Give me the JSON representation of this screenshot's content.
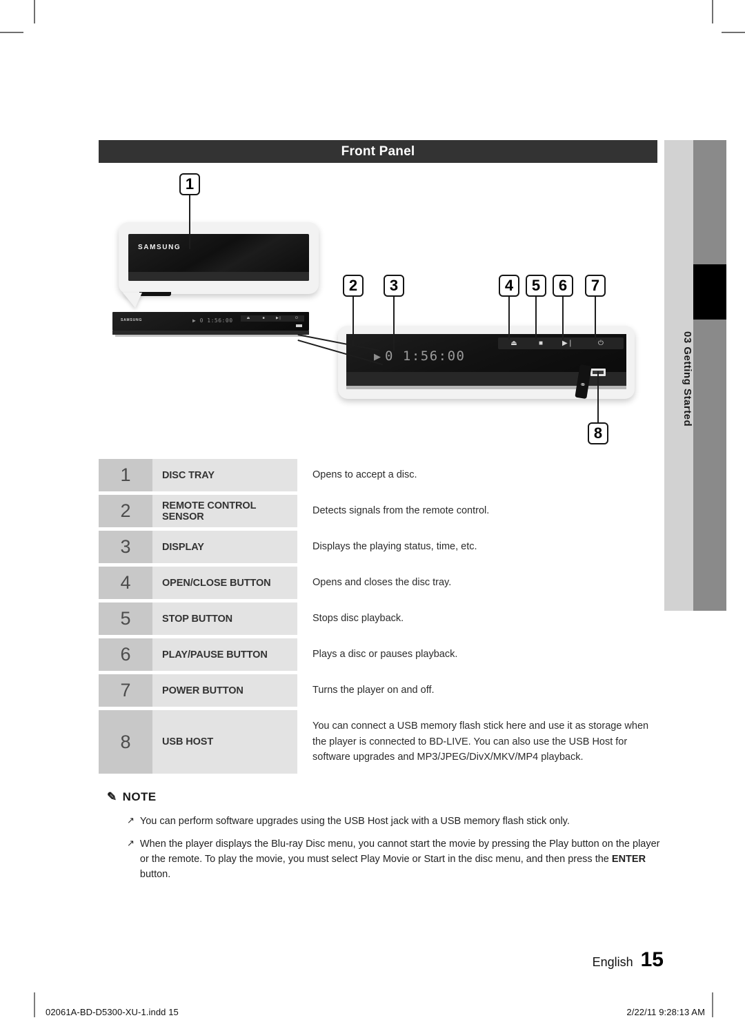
{
  "section": {
    "title": "Front Panel"
  },
  "side_tab": {
    "chapter_number": "03",
    "chapter_name": "Getting Started",
    "combined": "03  Getting Started"
  },
  "diagram": {
    "brand_logo": "SAMSUNG",
    "display_readout": "0 1:56:00",
    "display_play_icon": "▶",
    "buttons": [
      {
        "name": "eject-button-icon",
        "glyph": "⏏"
      },
      {
        "name": "stop-button-icon",
        "glyph": "■"
      },
      {
        "name": "play-pause-button-icon",
        "glyph": "▶❘"
      },
      {
        "name": "power-button-icon",
        "glyph": "⏻"
      }
    ],
    "usb_symbol": "⚭",
    "callouts": [
      "1",
      "2",
      "3",
      "4",
      "5",
      "6",
      "7",
      "8"
    ]
  },
  "spec_table": {
    "rows": [
      {
        "num": "1",
        "label": "DISC TRAY",
        "desc": "Opens to accept a disc."
      },
      {
        "num": "2",
        "label": "REMOTE CONTROL SENSOR",
        "desc": "Detects signals from the remote control."
      },
      {
        "num": "3",
        "label": "DISPLAY",
        "desc": "Displays the playing status, time, etc."
      },
      {
        "num": "4",
        "label": "OPEN/CLOSE BUTTON",
        "desc": "Opens and closes the disc tray."
      },
      {
        "num": "5",
        "label": "STOP BUTTON",
        "desc": "Stops disc playback."
      },
      {
        "num": "6",
        "label": "PLAY/PAUSE BUTTON",
        "desc": "Plays a disc or pauses playback."
      },
      {
        "num": "7",
        "label": "POWER BUTTON",
        "desc": "Turns the player on and off."
      },
      {
        "num": "8",
        "label": "USB HOST",
        "desc": "You can connect a USB memory flash stick here and use it as storage when the player is connected to BD-LIVE. You can also use the USB Host for software upgrades and MP3/JPEG/DivX/MKV/MP4 playback."
      }
    ]
  },
  "note": {
    "heading": "NOTE",
    "pencil_icon": "✎",
    "bullet": "↗",
    "items": [
      {
        "text_before": "You can perform software upgrades using the USB Host jack with a USB memory flash stick only.",
        "bold": "",
        "text_after": ""
      },
      {
        "text_before": "When the player displays the Blu-ray Disc menu, you cannot start the movie by pressing the Play button on the player or the remote. To play the movie, you must select Play Movie or Start in the disc menu, and then press the ",
        "bold": "ENTER",
        "text_after": " button."
      }
    ]
  },
  "footer": {
    "language": "English",
    "page_number": "15",
    "file_name": "02061A-BD-D5300-XU-1.indd   15",
    "timestamp": "2/22/11   9:28:13 AM"
  }
}
